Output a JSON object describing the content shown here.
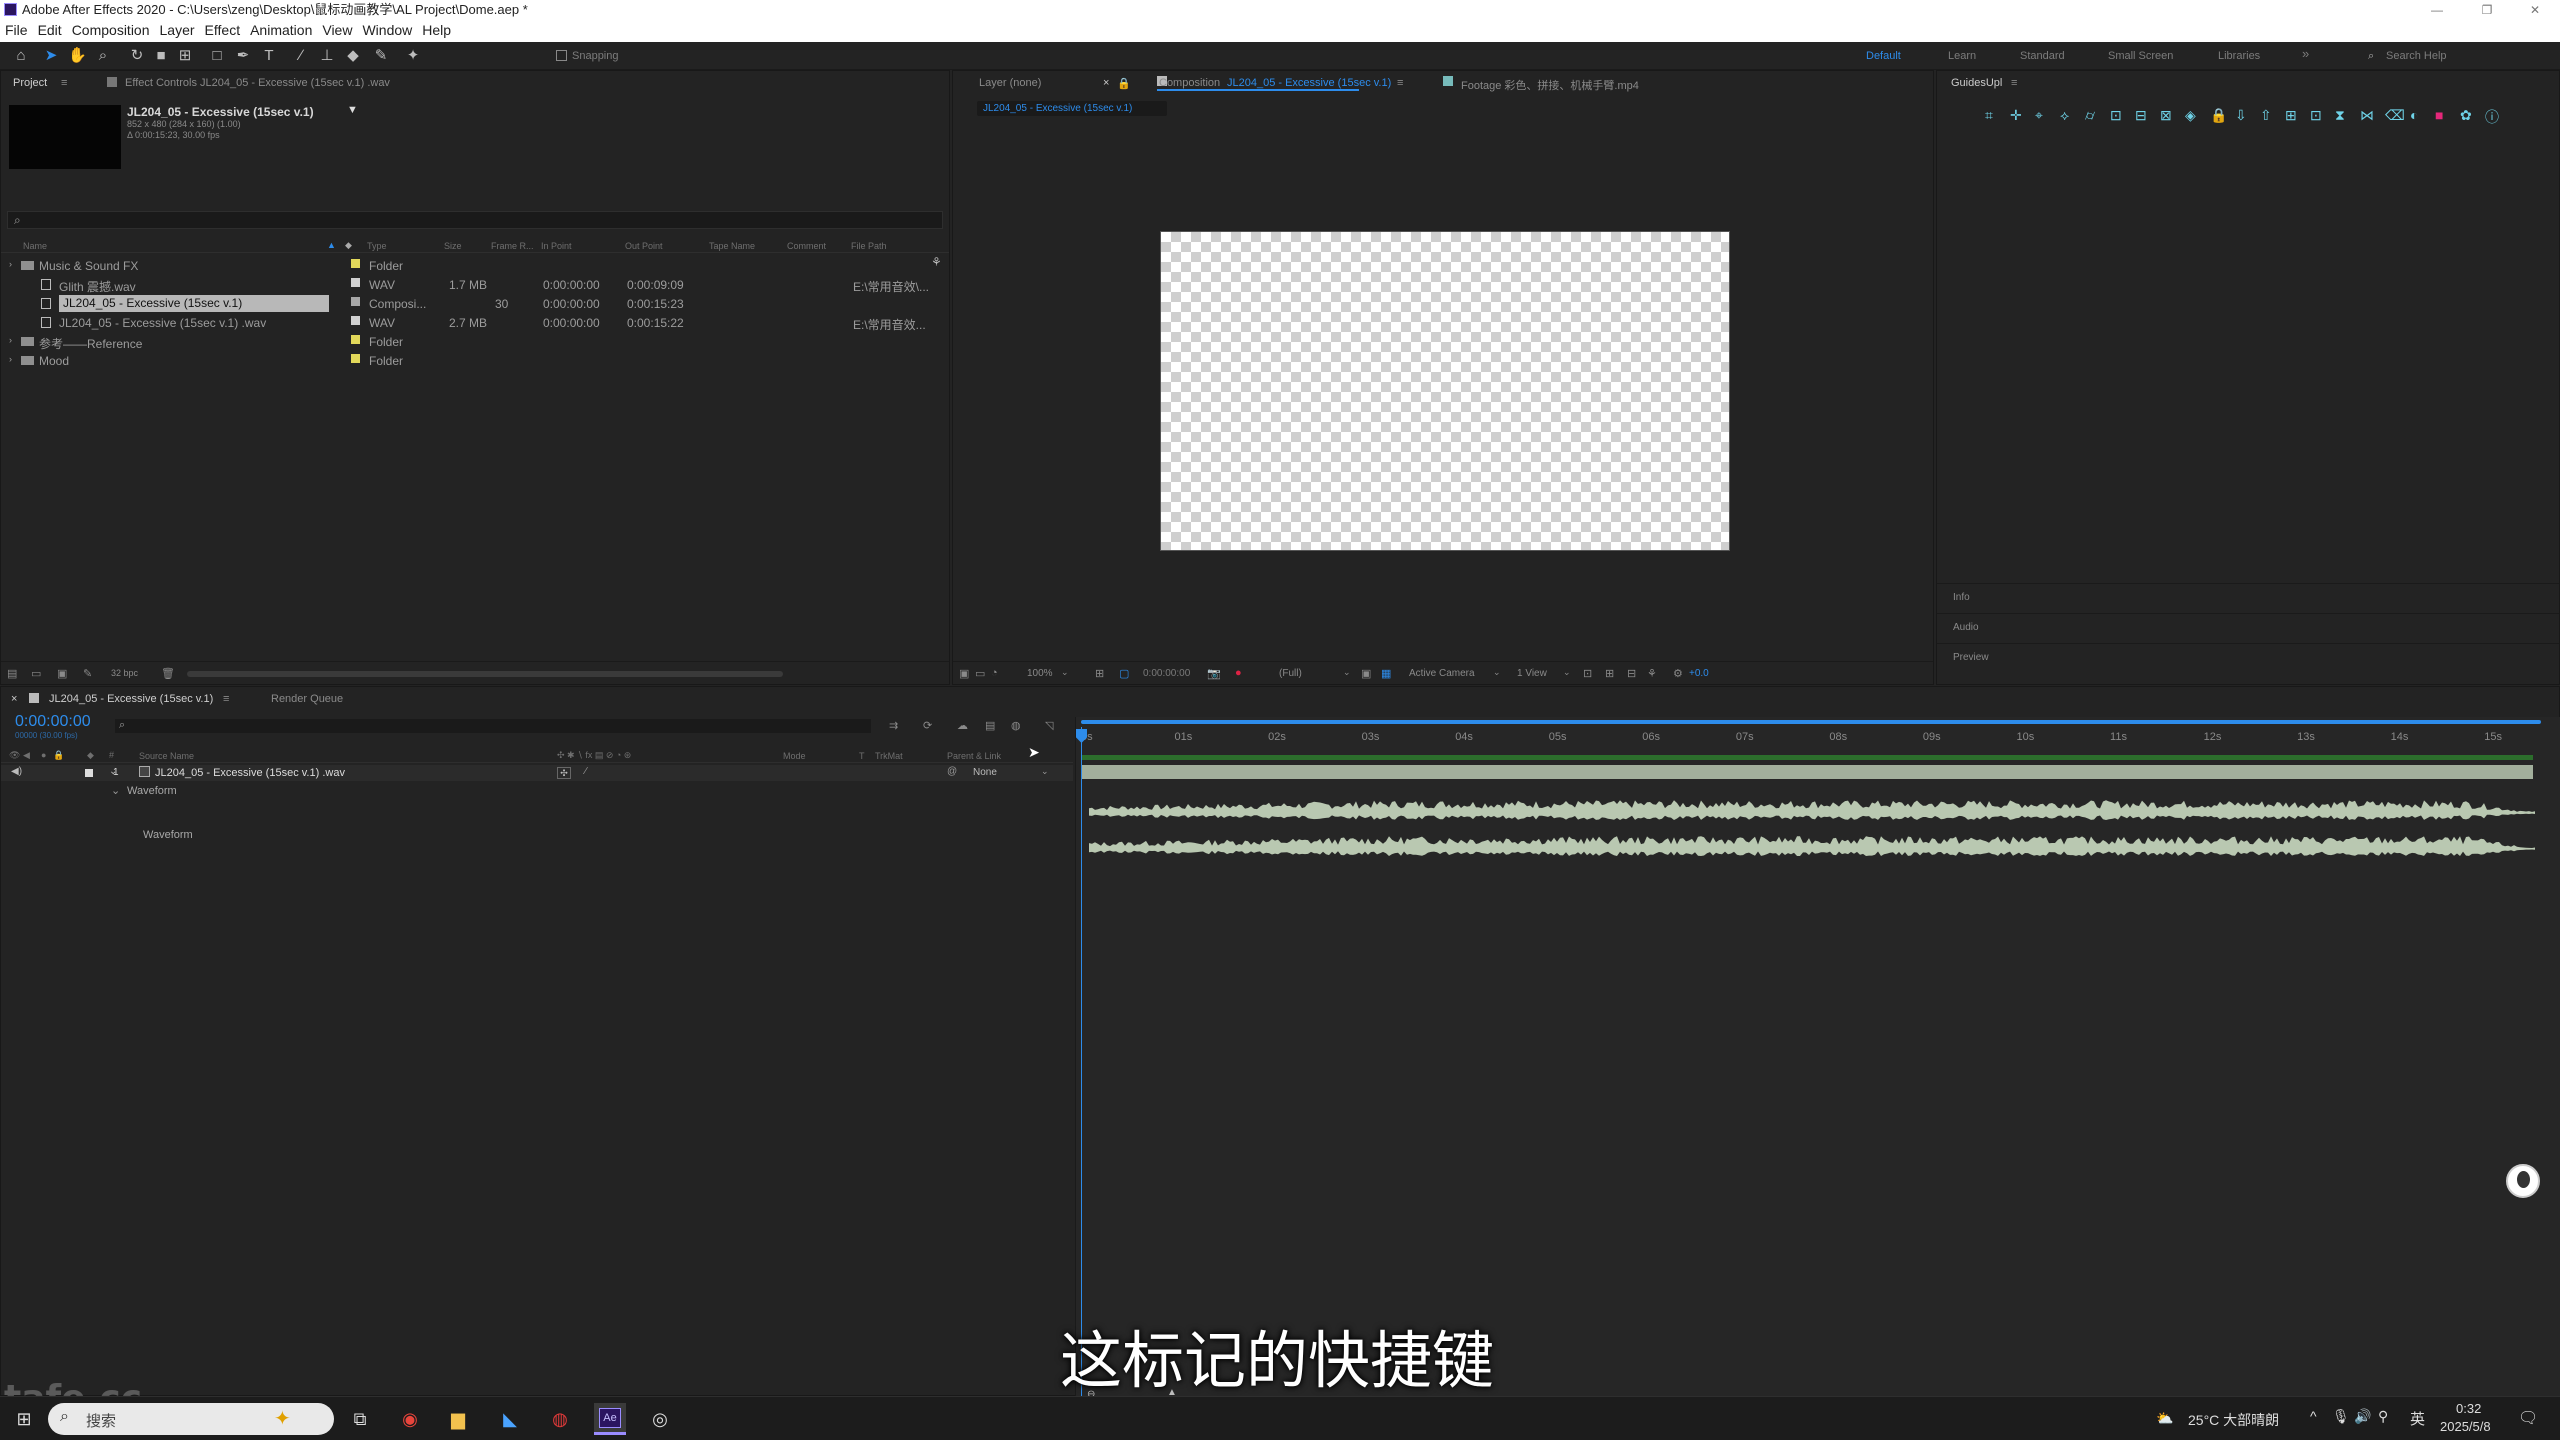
{
  "window": {
    "title": "Adobe After Effects 2020 - C:\\Users\\zeng\\Desktop\\鼠标动画教学\\AL Project\\Dome.aep *",
    "minimize": "—",
    "restore": "❐",
    "close": "✕"
  },
  "menu": [
    "File",
    "Edit",
    "Composition",
    "Layer",
    "Effect",
    "Animation",
    "View",
    "Window",
    "Help"
  ],
  "toolbar": {
    "snapping": "Snapping",
    "workspaces": [
      "Default",
      "Learn",
      "Standard",
      "Small Screen",
      "Libraries"
    ],
    "more": "»",
    "search_placeholder": "Search Help"
  },
  "project_panel": {
    "tab_project": "Project",
    "tab_effect_controls": "Effect Controls JL204_05 - Excessive (15sec v.1) .wav",
    "comp_name": "JL204_05 - Excessive (15sec v.1)",
    "comp_info1": "852 x 480 (284 x 160) (1.00)",
    "comp_info2": "Δ 0:00:15:23, 30.00 fps",
    "columns": [
      "Name",
      "Type",
      "Size",
      "Frame R...",
      "In Point",
      "Out Point",
      "Tape Name",
      "Comment",
      "File Path"
    ],
    "items": [
      {
        "name": "Music & Sound FX",
        "type": "Folder",
        "size": "",
        "fps": "",
        "in": "",
        "out": "",
        "path": "",
        "color": "#e2d85a",
        "kind": "folder",
        "indent": 0
      },
      {
        "name": "Glith 震撼.wav",
        "type": "WAV",
        "size": "1.7 MB",
        "fps": "",
        "in": "0:00:00:00",
        "out": "0:00:09:09",
        "path": "E:\\常用音效\\...",
        "color": "#d0d0d0",
        "kind": "file",
        "indent": 1
      },
      {
        "name": "JL204_05 - Excessive (15sec v.1)",
        "type": "Composi...",
        "size": "",
        "fps": "30",
        "in": "0:00:00:00",
        "out": "0:00:15:23",
        "path": "",
        "color": "#a7a7a7",
        "kind": "comp",
        "indent": 1
      },
      {
        "name": "JL204_05 - Excessive (15sec v.1) .wav",
        "type": "WAV",
        "size": "2.7 MB",
        "fps": "",
        "in": "0:00:00:00",
        "out": "0:00:15:22",
        "path": "E:\\常用音效...",
        "color": "#d0d0d0",
        "kind": "file",
        "indent": 1
      },
      {
        "name": "参考——Reference",
        "type": "Folder",
        "size": "",
        "fps": "",
        "in": "",
        "out": "",
        "path": "",
        "color": "#e2d85a",
        "kind": "folder",
        "indent": 0
      },
      {
        "name": "Mood",
        "type": "Folder",
        "size": "",
        "fps": "",
        "in": "",
        "out": "",
        "path": "",
        "color": "#e2d85a",
        "kind": "folder",
        "indent": 0
      }
    ],
    "bpc": "32 bpc"
  },
  "viewer": {
    "tab_layer": "Layer (none)",
    "tab_comp_prefix": "Composition",
    "tab_comp": "JL204_05 - Excessive (15sec v.1)",
    "tab_footage": "Footage 彩色、拼接、机械手臂.mp4",
    "breadcrumb": "JL204_05 - Excessive (15sec v.1)",
    "zoom": "100%",
    "timecode": "0:00:00:00",
    "resolution": "(Full)",
    "camera": "Active Camera",
    "views": "1 View",
    "exposure": "+0.0"
  },
  "right_panel": {
    "title": "GuidesUpl",
    "sections": [
      "Info",
      "Audio",
      "Preview"
    ],
    "icon_count": 21
  },
  "timeline": {
    "tab": "JL204_05 - Excessive (15sec v.1)",
    "render_queue": "Render Queue",
    "timecode": "0:00:00:00",
    "fps_info": "00000 (30.00 fps)",
    "col_source": "Source Name",
    "col_mode": "Mode",
    "col_trkmat": "TrkMat",
    "col_parent": "Parent & Link",
    "layer_num": "1",
    "layer_name": "JL204_05 - Excessive (15sec v.1) .wav",
    "parent": "None",
    "waveform_group": "Waveform",
    "waveform_prop": "Waveform",
    "ruler": [
      "0s",
      "01s",
      "02s",
      "03s",
      "04s",
      "05s",
      "06s",
      "07s",
      "08s",
      "09s",
      "10s",
      "11s",
      "12s",
      "13s",
      "14s",
      "15s"
    ]
  },
  "subtitle": "这标记的快捷键",
  "watermark": "tafe.cc",
  "taskbar": {
    "search": "搜索",
    "weather": "25°C 大部晴朗",
    "lang": "英",
    "time": "0:32",
    "date": "2025/5/8"
  },
  "colors": {
    "accent": "#2d8ceb",
    "waveform": "#b9c8b1",
    "label_folder": "#e2d85a",
    "timeline_bar": "#2c6e2c"
  }
}
